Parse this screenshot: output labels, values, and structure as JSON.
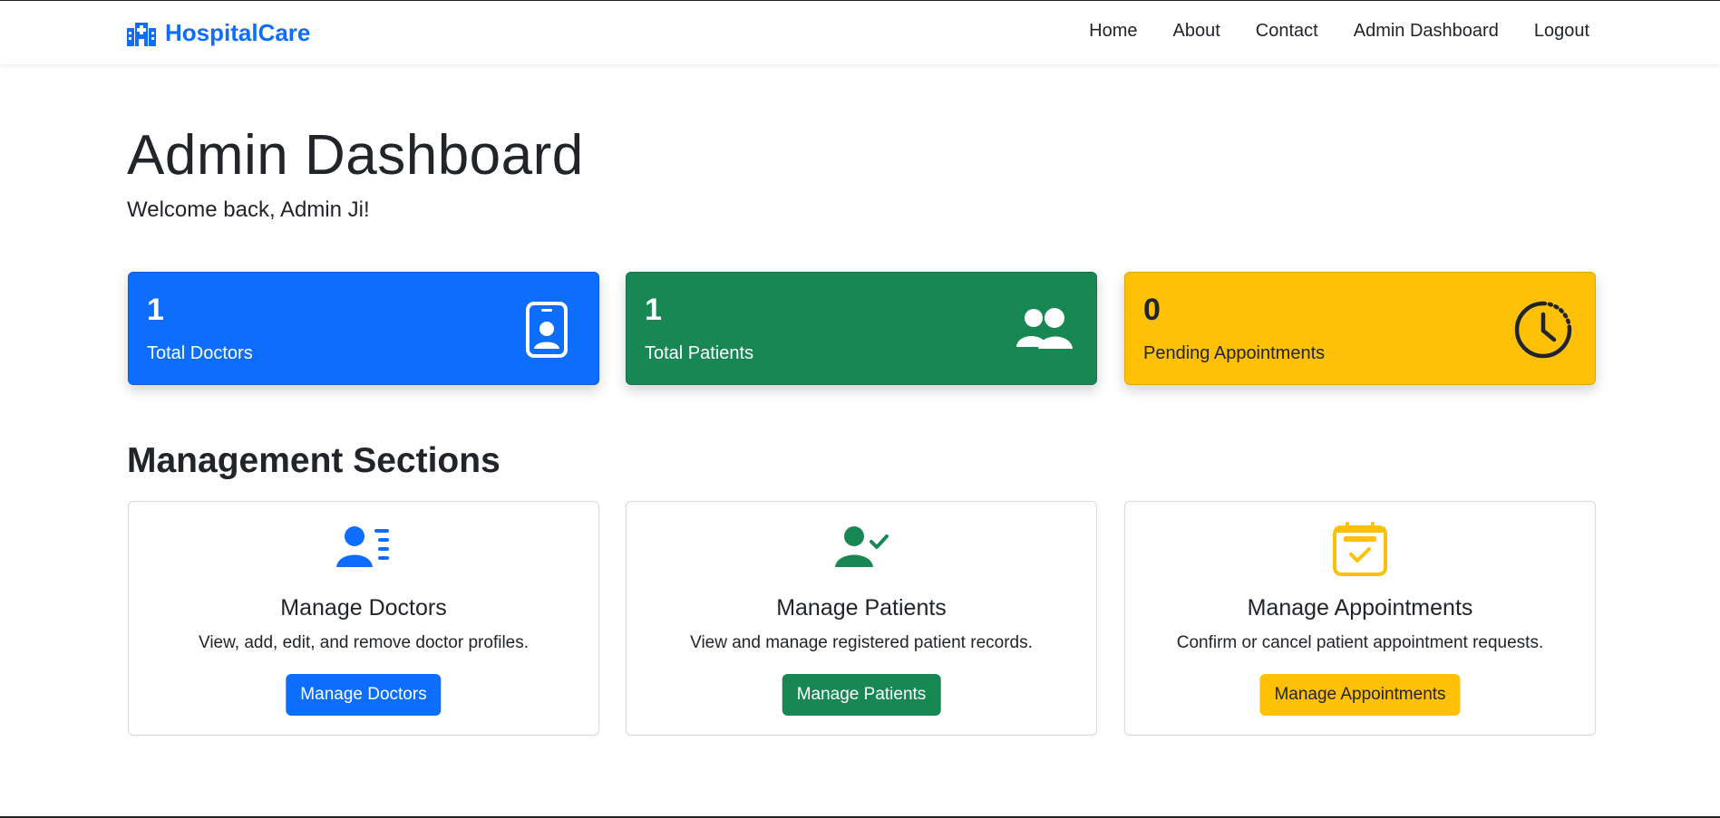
{
  "navbar": {
    "brand": "HospitalCare",
    "links": [
      "Home",
      "About",
      "Contact",
      "Admin Dashboard",
      "Logout"
    ]
  },
  "header": {
    "title": "Admin Dashboard",
    "welcome": "Welcome back, Admin Ji!"
  },
  "stats": [
    {
      "value": "1",
      "label": "Total Doctors",
      "icon": "id-badge-icon",
      "color": "#0d6efd"
    },
    {
      "value": "1",
      "label": "Total Patients",
      "icon": "people-icon",
      "color": "#198754"
    },
    {
      "value": "0",
      "label": "Pending Appointments",
      "icon": "clock-icon",
      "color": "#ffc107"
    }
  ],
  "management": {
    "title": "Management Sections",
    "cards": [
      {
        "title": "Manage Doctors",
        "description": "View, add, edit, and remove doctor profiles.",
        "button": "Manage Doctors",
        "icon": "person-list-icon",
        "color": "#0d6efd"
      },
      {
        "title": "Manage Patients",
        "description": "View and manage registered patient records.",
        "button": "Manage Patients",
        "icon": "person-check-icon",
        "color": "#198754"
      },
      {
        "title": "Manage Appointments",
        "description": "Confirm or cancel patient appointment requests.",
        "button": "Manage Appointments",
        "icon": "calendar-check-icon",
        "color": "#ffc107"
      }
    ]
  }
}
